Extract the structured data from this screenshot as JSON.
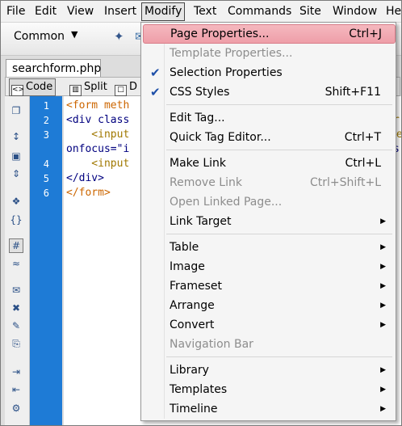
{
  "menubar": {
    "items": [
      "File",
      "Edit",
      "View",
      "Insert",
      "Modify",
      "Text",
      "Commands",
      "Site",
      "Window",
      "He"
    ]
  },
  "toolbar": {
    "category_label": "Common",
    "dropdown_arrow": "▼"
  },
  "document": {
    "tab_title": "searchform.php",
    "view_buttons": [
      "Code",
      "Split",
      "D"
    ]
  },
  "editor": {
    "line_numbers": [
      "1",
      "2",
      "3",
      "",
      "4",
      "5",
      "6"
    ],
    "lines": [
      "<form meth",
      "<div class",
      "    <input",
      "onfocus=\"i",
      "    <input",
      "</div>",
      "</form>"
    ],
    "right_overflow": [
      "r",
      "ne",
      "s"
    ]
  },
  "dropdown": {
    "items": [
      {
        "label": "Page Properties...",
        "shortcut": "Ctrl+J",
        "highlighted": true
      },
      {
        "label": "Template Properties...",
        "disabled": true
      },
      {
        "label": "Selection Properties",
        "checked": true
      },
      {
        "label": "CSS Styles",
        "shortcut": "Shift+F11",
        "checked": true
      },
      {
        "label": "Edit Tag..."
      },
      {
        "label": "Quick Tag Editor...",
        "shortcut": "Ctrl+T"
      },
      {
        "label": "Make Link",
        "shortcut": "Ctrl+L"
      },
      {
        "label": "Remove Link",
        "shortcut": "Ctrl+Shift+L",
        "disabled": true
      },
      {
        "label": "Open Linked Page...",
        "disabled": true
      },
      {
        "label": "Link Target",
        "submenu": true
      },
      {
        "label": "Table",
        "submenu": true
      },
      {
        "label": "Image",
        "submenu": true
      },
      {
        "label": "Frameset",
        "submenu": true
      },
      {
        "label": "Arrange",
        "submenu": true
      },
      {
        "label": "Convert",
        "submenu": true
      },
      {
        "label": "Navigation Bar",
        "disabled": true
      },
      {
        "label": "Library",
        "submenu": true
      },
      {
        "label": "Templates",
        "submenu": true
      },
      {
        "label": "Timeline",
        "submenu": true
      }
    ],
    "checkmark": "✔",
    "submenu_arrow": "▶"
  },
  "colors": {
    "gutter": "#1e7bd6",
    "highlight": "#f0a8b0"
  }
}
